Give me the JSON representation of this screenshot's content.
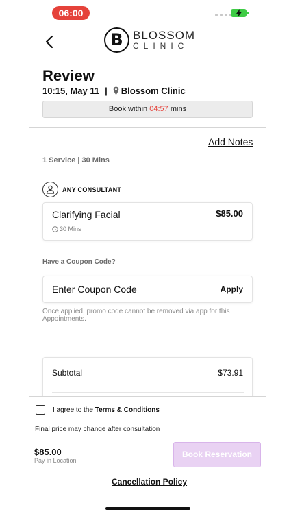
{
  "status_bar": {
    "time": "06:00",
    "battery_color": "#3ecb45",
    "time_pill_color": "#e5423a"
  },
  "header": {
    "back_icon": "chevron-left-icon",
    "logo_letter": "B",
    "logo_word": "BLOSSOM",
    "logo_sub": "CLINIC"
  },
  "review": {
    "title": "Review",
    "datetime": "10:15, May 11",
    "separator": "|",
    "location_icon": "map-pin-icon",
    "location": "Blossom Clinic",
    "timer_prefix": "Book within",
    "timer_value": "04:57",
    "timer_suffix": "mins",
    "timer_color": "#e5423a"
  },
  "add_notes_label": "Add Notes",
  "service_summary": "1 Service | 30 Mins",
  "consultant": {
    "icon": "user-icon",
    "label": "ANY CONSULTANT"
  },
  "service": {
    "name": "Clarifying Facial",
    "price": "$85.00",
    "duration_icon": "clock-icon",
    "duration": "30 Mins"
  },
  "coupon": {
    "question": "Have a Coupon Code?",
    "placeholder": "Enter Coupon Code",
    "apply_label": "Apply",
    "note": "Once applied, promo code cannot be removed via app for this Appointments."
  },
  "totals": {
    "subtotal_label": "Subtotal",
    "subtotal_value": "$73.91"
  },
  "footer": {
    "terms_prefix": "I agree to the",
    "terms_link": "Terms & Conditions",
    "price_note": "Final price may change after consultation",
    "total_price": "$85.00",
    "pay_note": "Pay in Location",
    "reserve_label": "Book Reservation",
    "reserve_color": "#e9d2f3",
    "cancellation_label": "Cancellation Policy"
  }
}
